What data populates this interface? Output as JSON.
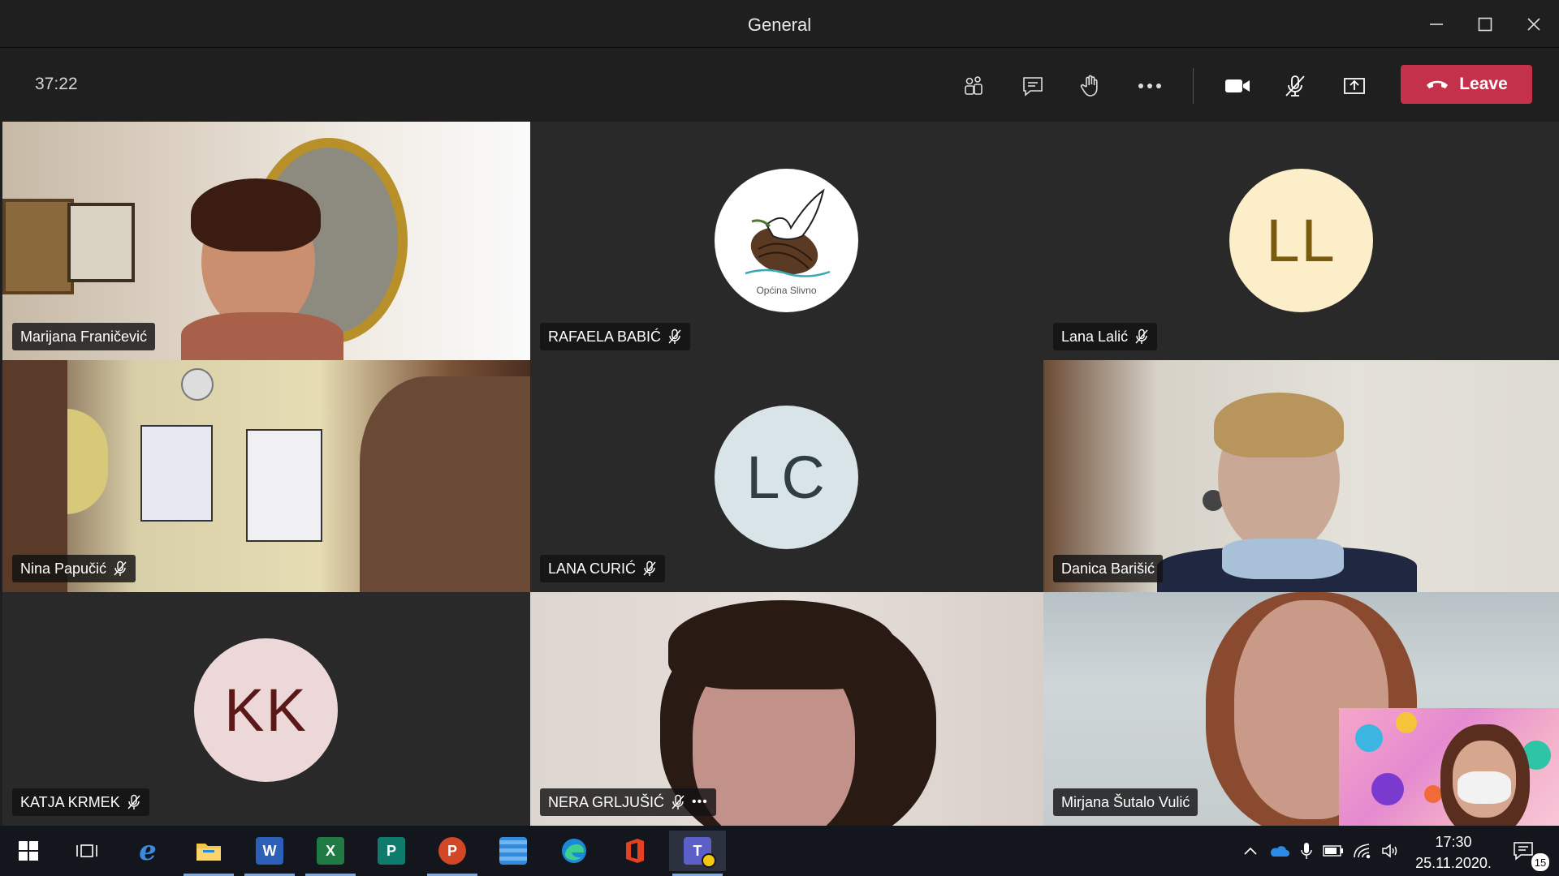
{
  "window": {
    "title": "General"
  },
  "meeting": {
    "timer": "37:22",
    "leave_label": "Leave"
  },
  "participants": [
    {
      "name": "Marijana Franičević",
      "muted": false,
      "video": true
    },
    {
      "name": "RAFAELA BABIĆ",
      "muted": true,
      "video": false,
      "avatar": "logo",
      "logo_text": "Općina Slivno"
    },
    {
      "name": "Lana Lalić",
      "muted": true,
      "video": false,
      "initials": "LL",
      "avatar_bg": "#fbeec8",
      "avatar_fg": "#7a5a0c"
    },
    {
      "name": "Nina Papučić",
      "muted": true,
      "video": true
    },
    {
      "name": "LANA CURIĆ",
      "muted": true,
      "video": false,
      "initials": "LC",
      "avatar_bg": "#d9e4e8",
      "avatar_fg": "#2f3e45"
    },
    {
      "name": "Danica Barišić",
      "muted": false,
      "video": true
    },
    {
      "name": "KATJA KRMEK",
      "muted": true,
      "video": false,
      "initials": "KK",
      "avatar_bg": "#ecd8d8",
      "avatar_fg": "#5a1818"
    },
    {
      "name": "NERA GRLJUŠIĆ",
      "muted": true,
      "video": true,
      "more": "•••"
    },
    {
      "name": "Mirjana Šutalo Vulić",
      "muted": false,
      "video": true
    }
  ],
  "taskbar": {
    "apps": [
      "start",
      "task-view",
      "internet-explorer",
      "file-explorer",
      "word",
      "excel",
      "publisher",
      "powerpoint",
      "app-blue",
      "edge",
      "office",
      "teams"
    ],
    "clock_time": "17:30",
    "clock_date": "25.11.2020.",
    "notification_count": "15"
  },
  "colors": {
    "leave": "#c4314b",
    "toolbar": "#1f1f1f",
    "tile": "#292929"
  }
}
